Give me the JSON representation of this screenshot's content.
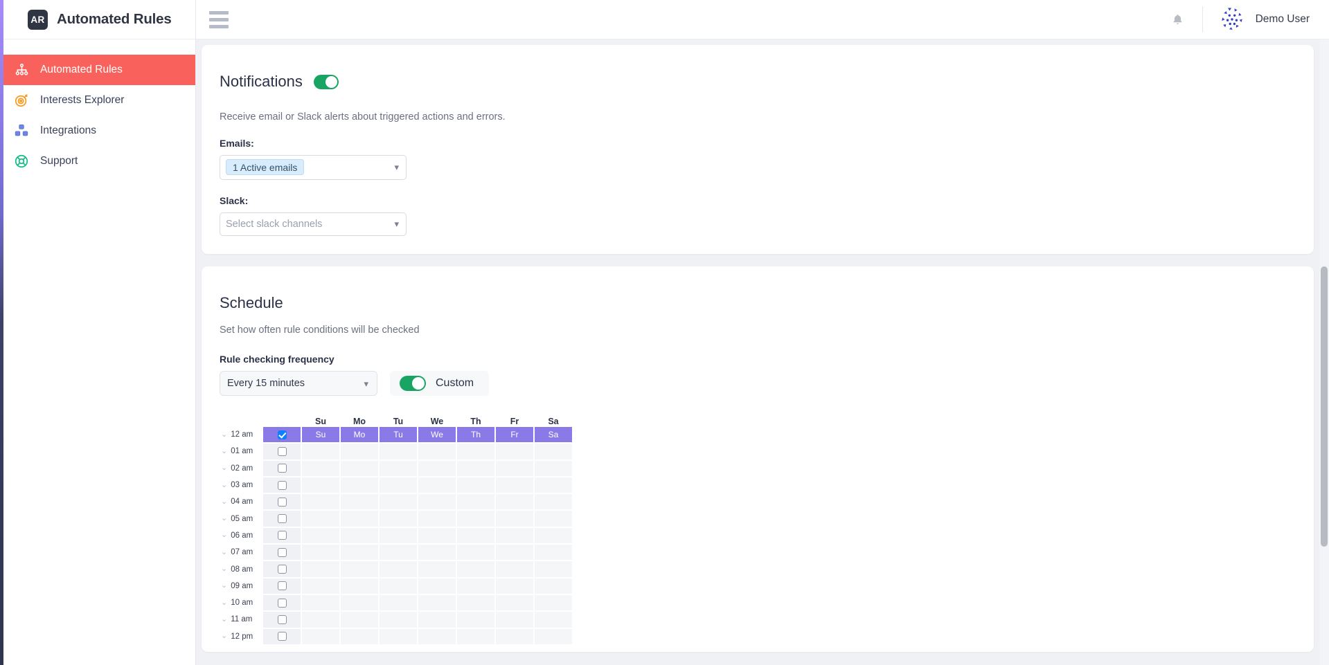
{
  "brand": {
    "logo_text": "AR",
    "title": "Automated Rules"
  },
  "sidebar": {
    "items": [
      {
        "label": "Automated Rules",
        "icon": "sitemap-icon",
        "active": true
      },
      {
        "label": "Interests Explorer",
        "icon": "target-icon",
        "active": false
      },
      {
        "label": "Integrations",
        "icon": "blocks-icon",
        "active": false
      },
      {
        "label": "Support",
        "icon": "lifebuoy-icon",
        "active": false
      }
    ]
  },
  "topbar": {
    "menu_icon": "hamburger-icon",
    "bell_icon": "bell-icon",
    "user_name": "Demo User",
    "avatar_icon": "identicon-avatar"
  },
  "notifications": {
    "title": "Notifications",
    "enabled": true,
    "description": "Receive email or Slack alerts about triggered actions and errors.",
    "emails_label": "Emails:",
    "emails_tag": "1 Active emails",
    "slack_label": "Slack:",
    "slack_placeholder": "Select slack channels"
  },
  "schedule": {
    "title": "Schedule",
    "description": "Set how often rule conditions will be checked",
    "frequency_label": "Rule checking frequency",
    "frequency_value": "Every 15 minutes",
    "custom_enabled": true,
    "custom_label": "Custom",
    "day_headers": [
      "Su",
      "Mo",
      "Tu",
      "We",
      "Th",
      "Fr",
      "Sa"
    ],
    "rows": [
      {
        "hour": "12 am",
        "checked": true,
        "selected": true
      },
      {
        "hour": "01 am",
        "checked": false,
        "selected": false
      },
      {
        "hour": "02 am",
        "checked": false,
        "selected": false
      },
      {
        "hour": "03 am",
        "checked": false,
        "selected": false
      },
      {
        "hour": "04 am",
        "checked": false,
        "selected": false
      },
      {
        "hour": "05 am",
        "checked": false,
        "selected": false
      },
      {
        "hour": "06 am",
        "checked": false,
        "selected": false
      },
      {
        "hour": "07 am",
        "checked": false,
        "selected": false
      },
      {
        "hour": "08 am",
        "checked": false,
        "selected": false
      },
      {
        "hour": "09 am",
        "checked": false,
        "selected": false
      },
      {
        "hour": "10 am",
        "checked": false,
        "selected": false
      },
      {
        "hour": "11 am",
        "checked": false,
        "selected": false
      },
      {
        "hour": "12 pm",
        "checked": false,
        "selected": false
      }
    ]
  },
  "colors": {
    "sidebar_active": "#f9625c",
    "toggle_on": "#18a563",
    "selected_row": "#8a7ae8",
    "checkbox_checked": "#0d7fff",
    "tag_bg": "#d8ecfb",
    "content_bg": "#f0f1f5"
  }
}
